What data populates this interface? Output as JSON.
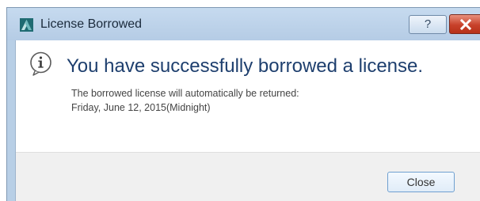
{
  "window": {
    "title": "License Borrowed",
    "help_label": "?",
    "app_icon": "autodesk-logo-icon",
    "close_icon": "close-icon"
  },
  "message": {
    "icon": "info-icon",
    "heading": "You have successfully borrowed a license.",
    "line1": "The borrowed license will automatically be returned:",
    "line2": "Friday, June 12, 2015(Midnight)"
  },
  "footer": {
    "close_label": "Close"
  },
  "colors": {
    "titlebar": "#b8cfe6",
    "heading_text": "#1e3f6e",
    "close_x_red": "#c8412a",
    "footer_bg": "#f0f0f0"
  }
}
